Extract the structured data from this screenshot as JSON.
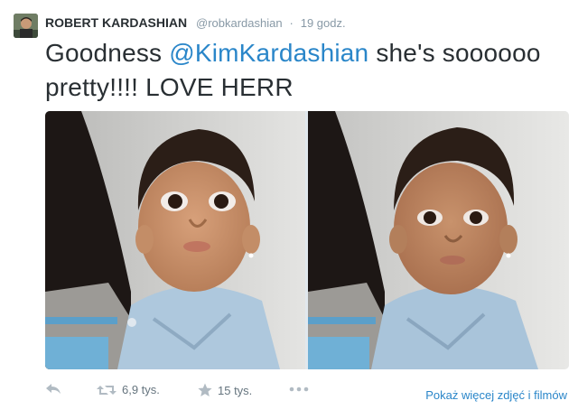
{
  "tweet": {
    "author_name": "ROBERT KARDASHIAN",
    "author_handle": "@robkardashian",
    "separator": "·",
    "timestamp": "19 godz.",
    "text_before": "Goodness ",
    "mention": "@KimKardashian",
    "text_after": " she's soooooo pretty!!!! LOVE HERR"
  },
  "actions": {
    "reply_icon": "reply-icon",
    "retweet_icon": "retweet-icon",
    "retweet_count": "6,9 tys.",
    "favorite_icon": "star-icon",
    "favorite_count": "15 tys.",
    "more_icon": "more-dots-icon",
    "more_media_link": "Pokaż więcej zdjęć i filmów"
  },
  "colors": {
    "link": "#2a86c9",
    "muted": "#8899a6",
    "text": "#292f33"
  }
}
